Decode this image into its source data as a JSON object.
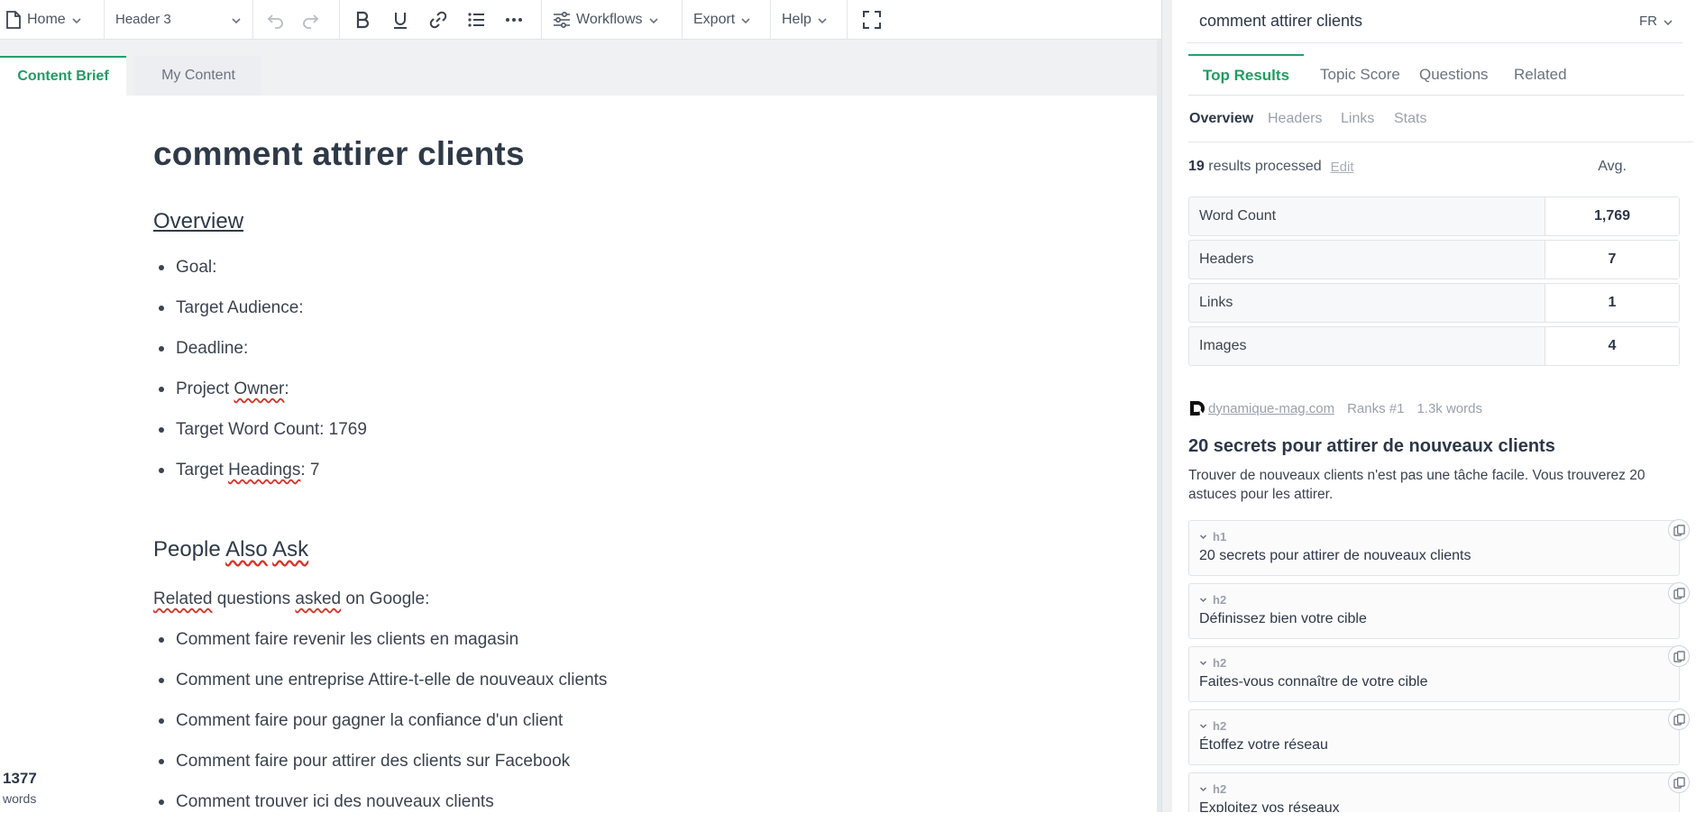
{
  "toolbar": {
    "home_label": "Home",
    "block_style": "Header 3",
    "workflows_label": "Workflows",
    "export_label": "Export",
    "help_label": "Help"
  },
  "editor_tabs": {
    "brief": "Content Brief",
    "content": "My Content"
  },
  "document": {
    "title": "comment attirer clients",
    "overview_heading": "Overview",
    "overview_items": [
      {
        "pre": "Goal:",
        "sq": "",
        "post": ""
      },
      {
        "pre": "Target Audience:",
        "sq": "",
        "post": ""
      },
      {
        "pre": "Deadline:",
        "sq": "",
        "post": ""
      },
      {
        "pre": "Project ",
        "sq": "Owner",
        "post": ":"
      },
      {
        "pre": "Target Word Count: 1769",
        "sq": "",
        "post": ""
      },
      {
        "pre": "Target ",
        "sq": "Headings",
        "post": ": 7"
      }
    ],
    "paa_heading": {
      "w1": "People",
      "w2": "Also",
      "w3": "Ask"
    },
    "related": {
      "w1": "Related",
      "mid": " questions ",
      "w2": "asked",
      "post": " on Google:"
    },
    "paa_items": [
      "Comment faire revenir les clients en magasin",
      "Comment une entreprise Attire-t-elle de nouveaux clients",
      "Comment faire pour gagner la confiance d'un client",
      "Comment faire pour attirer des clients sur Facebook",
      "Comment trouver ici des nouveaux clients"
    ]
  },
  "word_count": {
    "value": "1377",
    "label": "words"
  },
  "research": {
    "query": "comment attirer clients",
    "language": "FR",
    "tabs": [
      "Top Results",
      "Topic Score",
      "Questions",
      "Related"
    ],
    "subtabs": [
      "Overview",
      "Headers",
      "Links",
      "Stats"
    ],
    "results_count": "19",
    "results_label": " results processed",
    "edit_label": "Edit",
    "avg_label": "Avg.",
    "stats": [
      {
        "label": "Word Count",
        "value": "1,769"
      },
      {
        "label": "Headers",
        "value": "7"
      },
      {
        "label": "Links",
        "value": "1"
      },
      {
        "label": "Images",
        "value": "4"
      }
    ],
    "result": {
      "domain": "dynamique-mag.com",
      "rank": "Ranks #1",
      "words": "1.3k words",
      "title": "20 secrets pour attirer de nouveaux clients",
      "description": "Trouver de nouveaux clients n'est pas une tâche facile. Vous trouverez 20 astuces pour les attirer.",
      "headers": [
        {
          "level": "h1",
          "text": "20 secrets pour attirer de nouveaux clients"
        },
        {
          "level": "h2",
          "text": "Définissez bien votre cible"
        },
        {
          "level": "h2",
          "text": "Faites-vous connaître de votre cible"
        },
        {
          "level": "h2",
          "text": "Étoffez votre réseau"
        },
        {
          "level": "h2",
          "text": "Exploitez vos réseaux"
        }
      ]
    }
  },
  "colors": {
    "accent": "#22a06b",
    "spell_error": "#d9342b"
  }
}
